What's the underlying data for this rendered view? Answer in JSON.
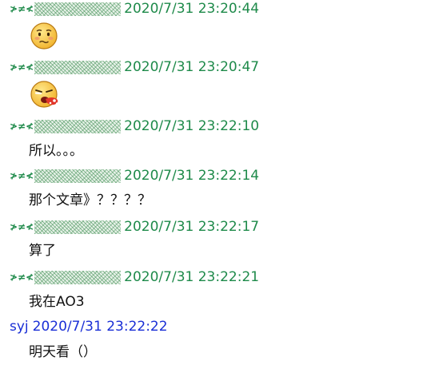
{
  "messages": [
    {
      "sender_prefix": "≯≠≮",
      "timestamp": "2020/7/31 23:20:44",
      "content_type": "emoji",
      "emoji": "worried-face-emoji",
      "text": ""
    },
    {
      "sender_prefix": "≯≠≮",
      "timestamp": "2020/7/31 23:20:47",
      "content_type": "emoji",
      "emoji": "vomiting-face-emoji",
      "text": ""
    },
    {
      "sender_prefix": "≯≠≮",
      "timestamp": "2020/7/31 23:22:10",
      "content_type": "text",
      "text": "所以。。。"
    },
    {
      "sender_prefix": "≯≠≮",
      "timestamp": "2020/7/31 23:22:14",
      "content_type": "text",
      "text": "那个文章》？？？？"
    },
    {
      "sender_prefix": "≯≠≮",
      "timestamp": "2020/7/31 23:22:17",
      "content_type": "text",
      "text": "算了"
    },
    {
      "sender_prefix": "≯≠≮",
      "timestamp": "2020/7/31 23:22:21",
      "content_type": "text",
      "text": "我在AO3"
    },
    {
      "sender_name": "syj",
      "timestamp": "2020/7/31 23:22:22",
      "content_type": "text",
      "text": "明天看（）"
    }
  ],
  "colors": {
    "other_sender": "#1e8a4a",
    "self_sender": "#1a2fd6",
    "message_text": "#111111",
    "background": "#ffffff"
  }
}
